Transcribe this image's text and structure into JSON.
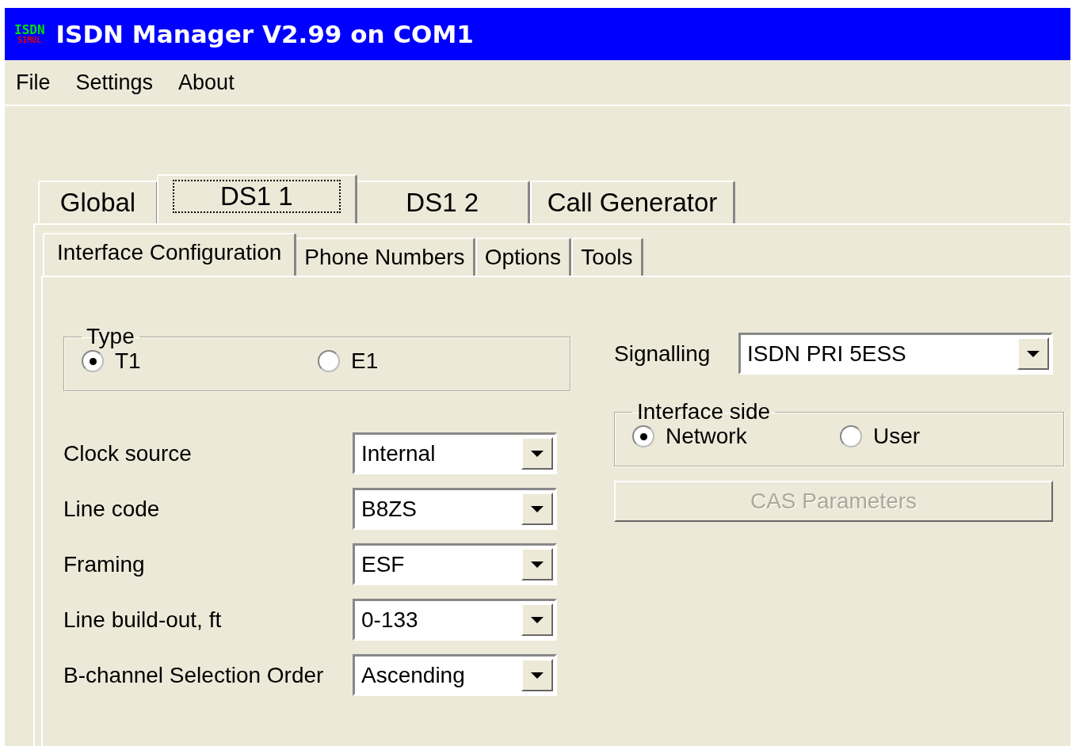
{
  "window": {
    "title": "ISDN Manager V2.99 on COM1",
    "icon_text": [
      "ISDN",
      "SIMUL"
    ]
  },
  "menu": [
    "File",
    "Settings",
    "About"
  ],
  "tabs": [
    {
      "label": "Global",
      "selected": false,
      "focused": false
    },
    {
      "label": "DS1 1",
      "selected": true,
      "focused": true
    },
    {
      "label": "DS1 2",
      "selected": false,
      "focused": false
    },
    {
      "label": "Call Generator",
      "selected": false,
      "focused": false
    }
  ],
  "subtabs": [
    {
      "label": "Interface Configuration",
      "selected": true
    },
    {
      "label": "Phone Numbers",
      "selected": false
    },
    {
      "label": "Options",
      "selected": false
    },
    {
      "label": "Tools",
      "selected": false
    }
  ],
  "type_group": {
    "label": "Type",
    "options": [
      {
        "label": "T1",
        "selected": true
      },
      {
        "label": "E1",
        "selected": false
      }
    ]
  },
  "fields": [
    {
      "label": "Clock source",
      "value": "Internal"
    },
    {
      "label": "Line code",
      "value": "B8ZS"
    },
    {
      "label": "Framing",
      "value": "ESF"
    },
    {
      "label": "Line build-out, ft",
      "value": "0-133"
    },
    {
      "label": "B-channel Selection Order",
      "value": "Ascending"
    }
  ],
  "signalling": {
    "label": "Signalling",
    "value": "ISDN PRI 5ESS"
  },
  "interface_side": {
    "label": "Interface side",
    "options": [
      {
        "label": "Network",
        "selected": true
      },
      {
        "label": "User",
        "selected": false
      }
    ]
  },
  "cas_button": {
    "label": "CAS Parameters",
    "disabled": true
  }
}
